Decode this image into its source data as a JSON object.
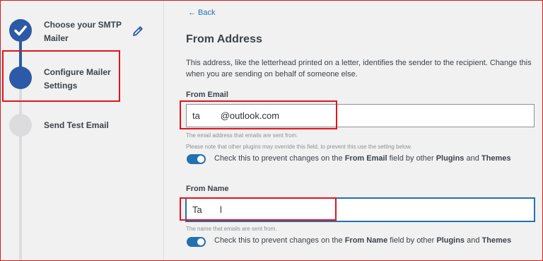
{
  "steps": [
    {
      "label_line1": "Choose your SMTP",
      "label_line2": "Mailer",
      "state": "complete"
    },
    {
      "label_line1": "Configure Mailer",
      "label_line2": "Settings",
      "state": "current"
    },
    {
      "label_line1": "Send Test Email",
      "label_line2": "",
      "state": "pending"
    }
  ],
  "icons": {
    "step_complete": "checkmark-icon",
    "edit": "pencil-icon",
    "back": "arrow-left-icon"
  },
  "colors": {
    "accent": "#2271b1",
    "step_done": "#2d5aa6",
    "step_pending": "#dcdcde",
    "annotation": "#e3141b"
  },
  "back_link": "← Back",
  "section": {
    "title": "From Address",
    "description": "This address, like the letterhead printed on a letter, identifies the sender to the recipient. Change this when you are sending on behalf of someone else."
  },
  "from_email": {
    "label": "From Email",
    "value": "ta        @outlook.com",
    "help1": "The email address that emails are sent from.",
    "help2": "Please note that other plugins may override this field, to prevent this use the setting below.",
    "toggle_on": true,
    "toggle_pre": "Check this to prevent changes on the",
    "toggle_b1": "From Email",
    "toggle_mid": "field by other",
    "toggle_b2": "Plugins",
    "toggle_and": "and",
    "toggle_b3": "Themes"
  },
  "from_name": {
    "label": "From Name",
    "value": "Ta       l",
    "help1": "The name that emails are sent from.",
    "toggle_on": true,
    "toggle_pre": "Check this to prevent changes on the",
    "toggle_b1": "From Name",
    "toggle_mid": "field by other",
    "toggle_b2": "Plugins",
    "toggle_and": "and",
    "toggle_b3": "Themes"
  }
}
